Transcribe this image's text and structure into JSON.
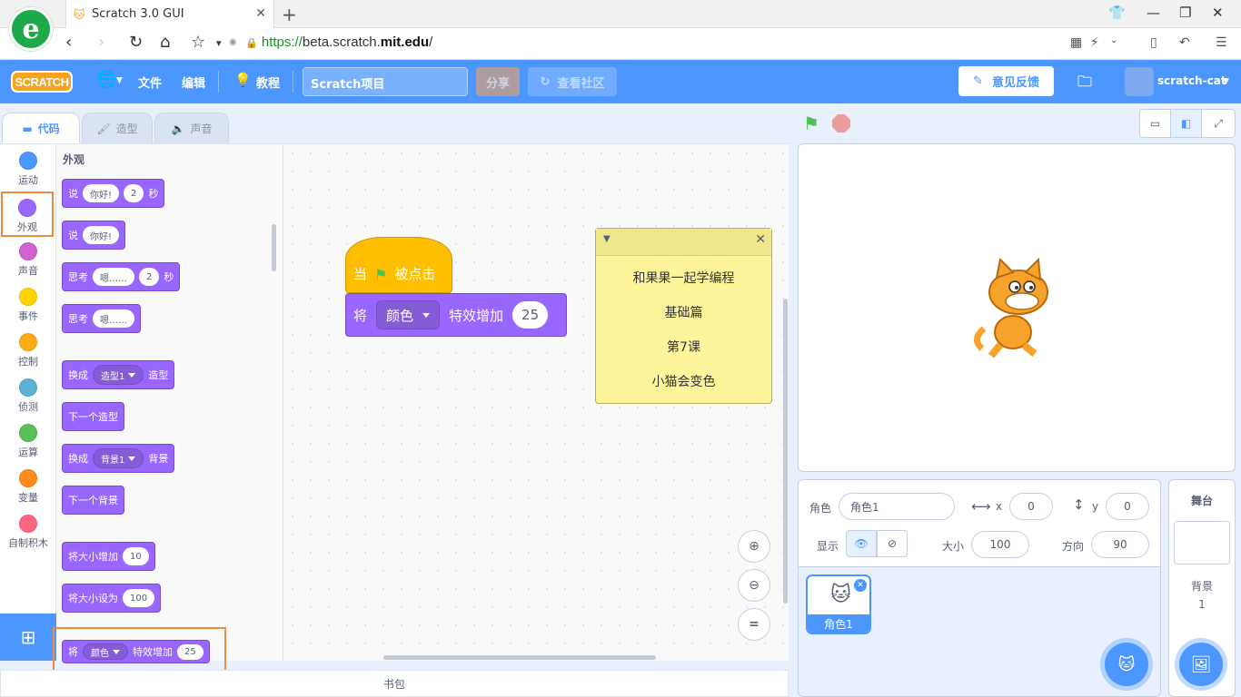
{
  "browser": {
    "tab_title": "Scratch 3.0 GUI",
    "url_scheme": "https://",
    "url_host_prefix": "beta.scratch.",
    "url_host_bold": "mit.edu",
    "url_path": "/"
  },
  "menu": {
    "logo": "SCRATCH",
    "file": "文件",
    "edit": "编辑",
    "tutorials": "教程",
    "project_title": "Scratch项目",
    "share": "分享",
    "see_community": "查看社区",
    "feedback": "意见反馈",
    "username": "scratch-cat"
  },
  "editor_tabs": {
    "code": "代码",
    "costumes": "造型",
    "sounds": "声音"
  },
  "categories": [
    {
      "label": "运动",
      "color": "#4c97ff"
    },
    {
      "label": "外观",
      "color": "#9966ff"
    },
    {
      "label": "声音",
      "color": "#cf63cf"
    },
    {
      "label": "事件",
      "color": "#ffd500"
    },
    {
      "label": "控制",
      "color": "#ffab19"
    },
    {
      "label": "侦测",
      "color": "#5cb1d6"
    },
    {
      "label": "运算",
      "color": "#59c059"
    },
    {
      "label": "变量",
      "color": "#ff8c1a"
    },
    {
      "label": "自制积木",
      "color": "#ff6680"
    }
  ],
  "palette": {
    "heading": "外观",
    "say_for": {
      "a": "说",
      "msg": "你好!",
      "secs": "2",
      "b": "秒"
    },
    "say": {
      "a": "说",
      "msg": "你好!"
    },
    "think_for": {
      "a": "思考",
      "msg": "嗯……",
      "secs": "2",
      "b": "秒"
    },
    "think": {
      "a": "思考",
      "msg": "嗯……"
    },
    "switch_costume": {
      "a": "换成",
      "costume": "造型1",
      "b": "造型"
    },
    "next_costume": "下一个造型",
    "switch_backdrop": {
      "a": "换成",
      "backdrop": "背景1",
      "b": "背景"
    },
    "next_backdrop": "下一个背景",
    "change_size": {
      "a": "将大小增加",
      "val": "10"
    },
    "set_size": {
      "a": "将大小设为",
      "val": "100"
    },
    "change_effect": {
      "a": "将",
      "effect": "颜色",
      "b": "特效增加",
      "val": "25"
    }
  },
  "script": {
    "hat_when": "当",
    "hat_clicked": "被点击",
    "effect_a": "将",
    "effect_name": "颜色",
    "effect_b": "特效增加",
    "effect_val": "25"
  },
  "note": {
    "line1": "和果果一起学编程",
    "line2": "基础篇",
    "line3": "第7课",
    "line4": "小猫会变色"
  },
  "zoom": {
    "reset": "="
  },
  "backpack": "书包",
  "sprite_info": {
    "sprite_label": "角色",
    "sprite_name": "角色1",
    "x_label": "x",
    "x": "0",
    "y_label": "y",
    "y": "0",
    "show_label": "显示",
    "size_label": "大小",
    "size": "100",
    "direction_label": "方向",
    "direction": "90"
  },
  "sprite_tile": {
    "name": "角色1"
  },
  "stage_pane": {
    "title": "舞台",
    "backdrops_label": "背景",
    "backdrops_count": "1"
  }
}
